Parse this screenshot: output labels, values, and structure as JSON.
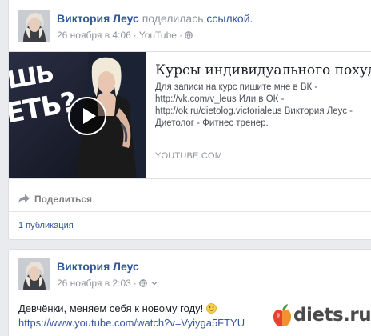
{
  "post1": {
    "author": "Виктория Леус",
    "action": "поделилась",
    "action_link": "ссылкой.",
    "time": "26 ноября в 4:06",
    "source": "YouTube",
    "separator": "·",
    "preview": {
      "title": "Курсы индивидуального похудения",
      "description": "Для записи на курс пишите мне в ВК - http://vk.com/v_leus Или в ОК - http://ok.ru/dietolog.victorialeus Виктория Леус - Диетолог - Фитнес тренер.",
      "domain": "YOUTUBE.COM",
      "thumb_text_1": "ШЬ",
      "thumb_text_2": "ЕТЬ?"
    },
    "share_label": "Поделиться",
    "publications": "1 публикация"
  },
  "post2": {
    "author": "Виктория Леус",
    "time": "26 ноября в 2:03",
    "separator": "·",
    "text": "Девчёнки, меняем себя к новому году!",
    "url": "https://www.youtube.com/watch?v=Vyiyga5FTYU"
  },
  "watermark": {
    "text": "diets.ru"
  },
  "colors": {
    "link": "#365899",
    "meta": "#90949c",
    "background": "#e9ebee"
  }
}
